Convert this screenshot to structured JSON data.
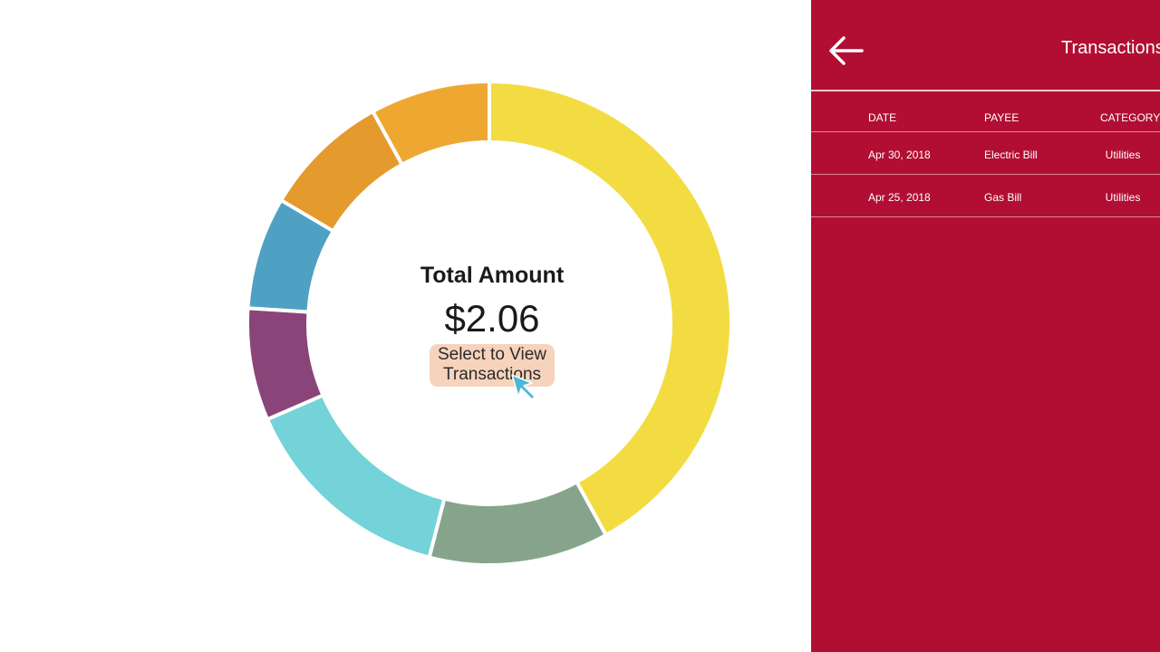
{
  "center": {
    "total_label": "Total Amount",
    "total_value": "$2.06",
    "select_button_label": "Select to View Transactions"
  },
  "panel": {
    "title": "Transactions",
    "columns": [
      "DATE",
      "PAYEE",
      "CATEGORY"
    ],
    "rows": [
      {
        "date": "Apr 30, 2018",
        "payee": "Electric Bill",
        "category": "Utilities"
      },
      {
        "date": "Apr 25, 2018",
        "payee": "Gas Bill",
        "category": "Utilities"
      }
    ]
  },
  "colors": {
    "panel_background": "#b20e33",
    "button_background": "#f6d3bc",
    "cursor": "#4bb8d6"
  },
  "chart_data": {
    "type": "pie",
    "style": "donut",
    "segments": [
      {
        "value": 42,
        "color": "#f2dc41"
      },
      {
        "value": 12,
        "color": "#86a48b"
      },
      {
        "value": 14.5,
        "color": "#73d3d9"
      },
      {
        "value": 7.5,
        "color": "#894579"
      },
      {
        "value": 7.5,
        "color": "#4ea1c2"
      },
      {
        "value": 8.5,
        "color": "#e49a2d"
      },
      {
        "value": 8,
        "color": "#eea831"
      }
    ]
  }
}
